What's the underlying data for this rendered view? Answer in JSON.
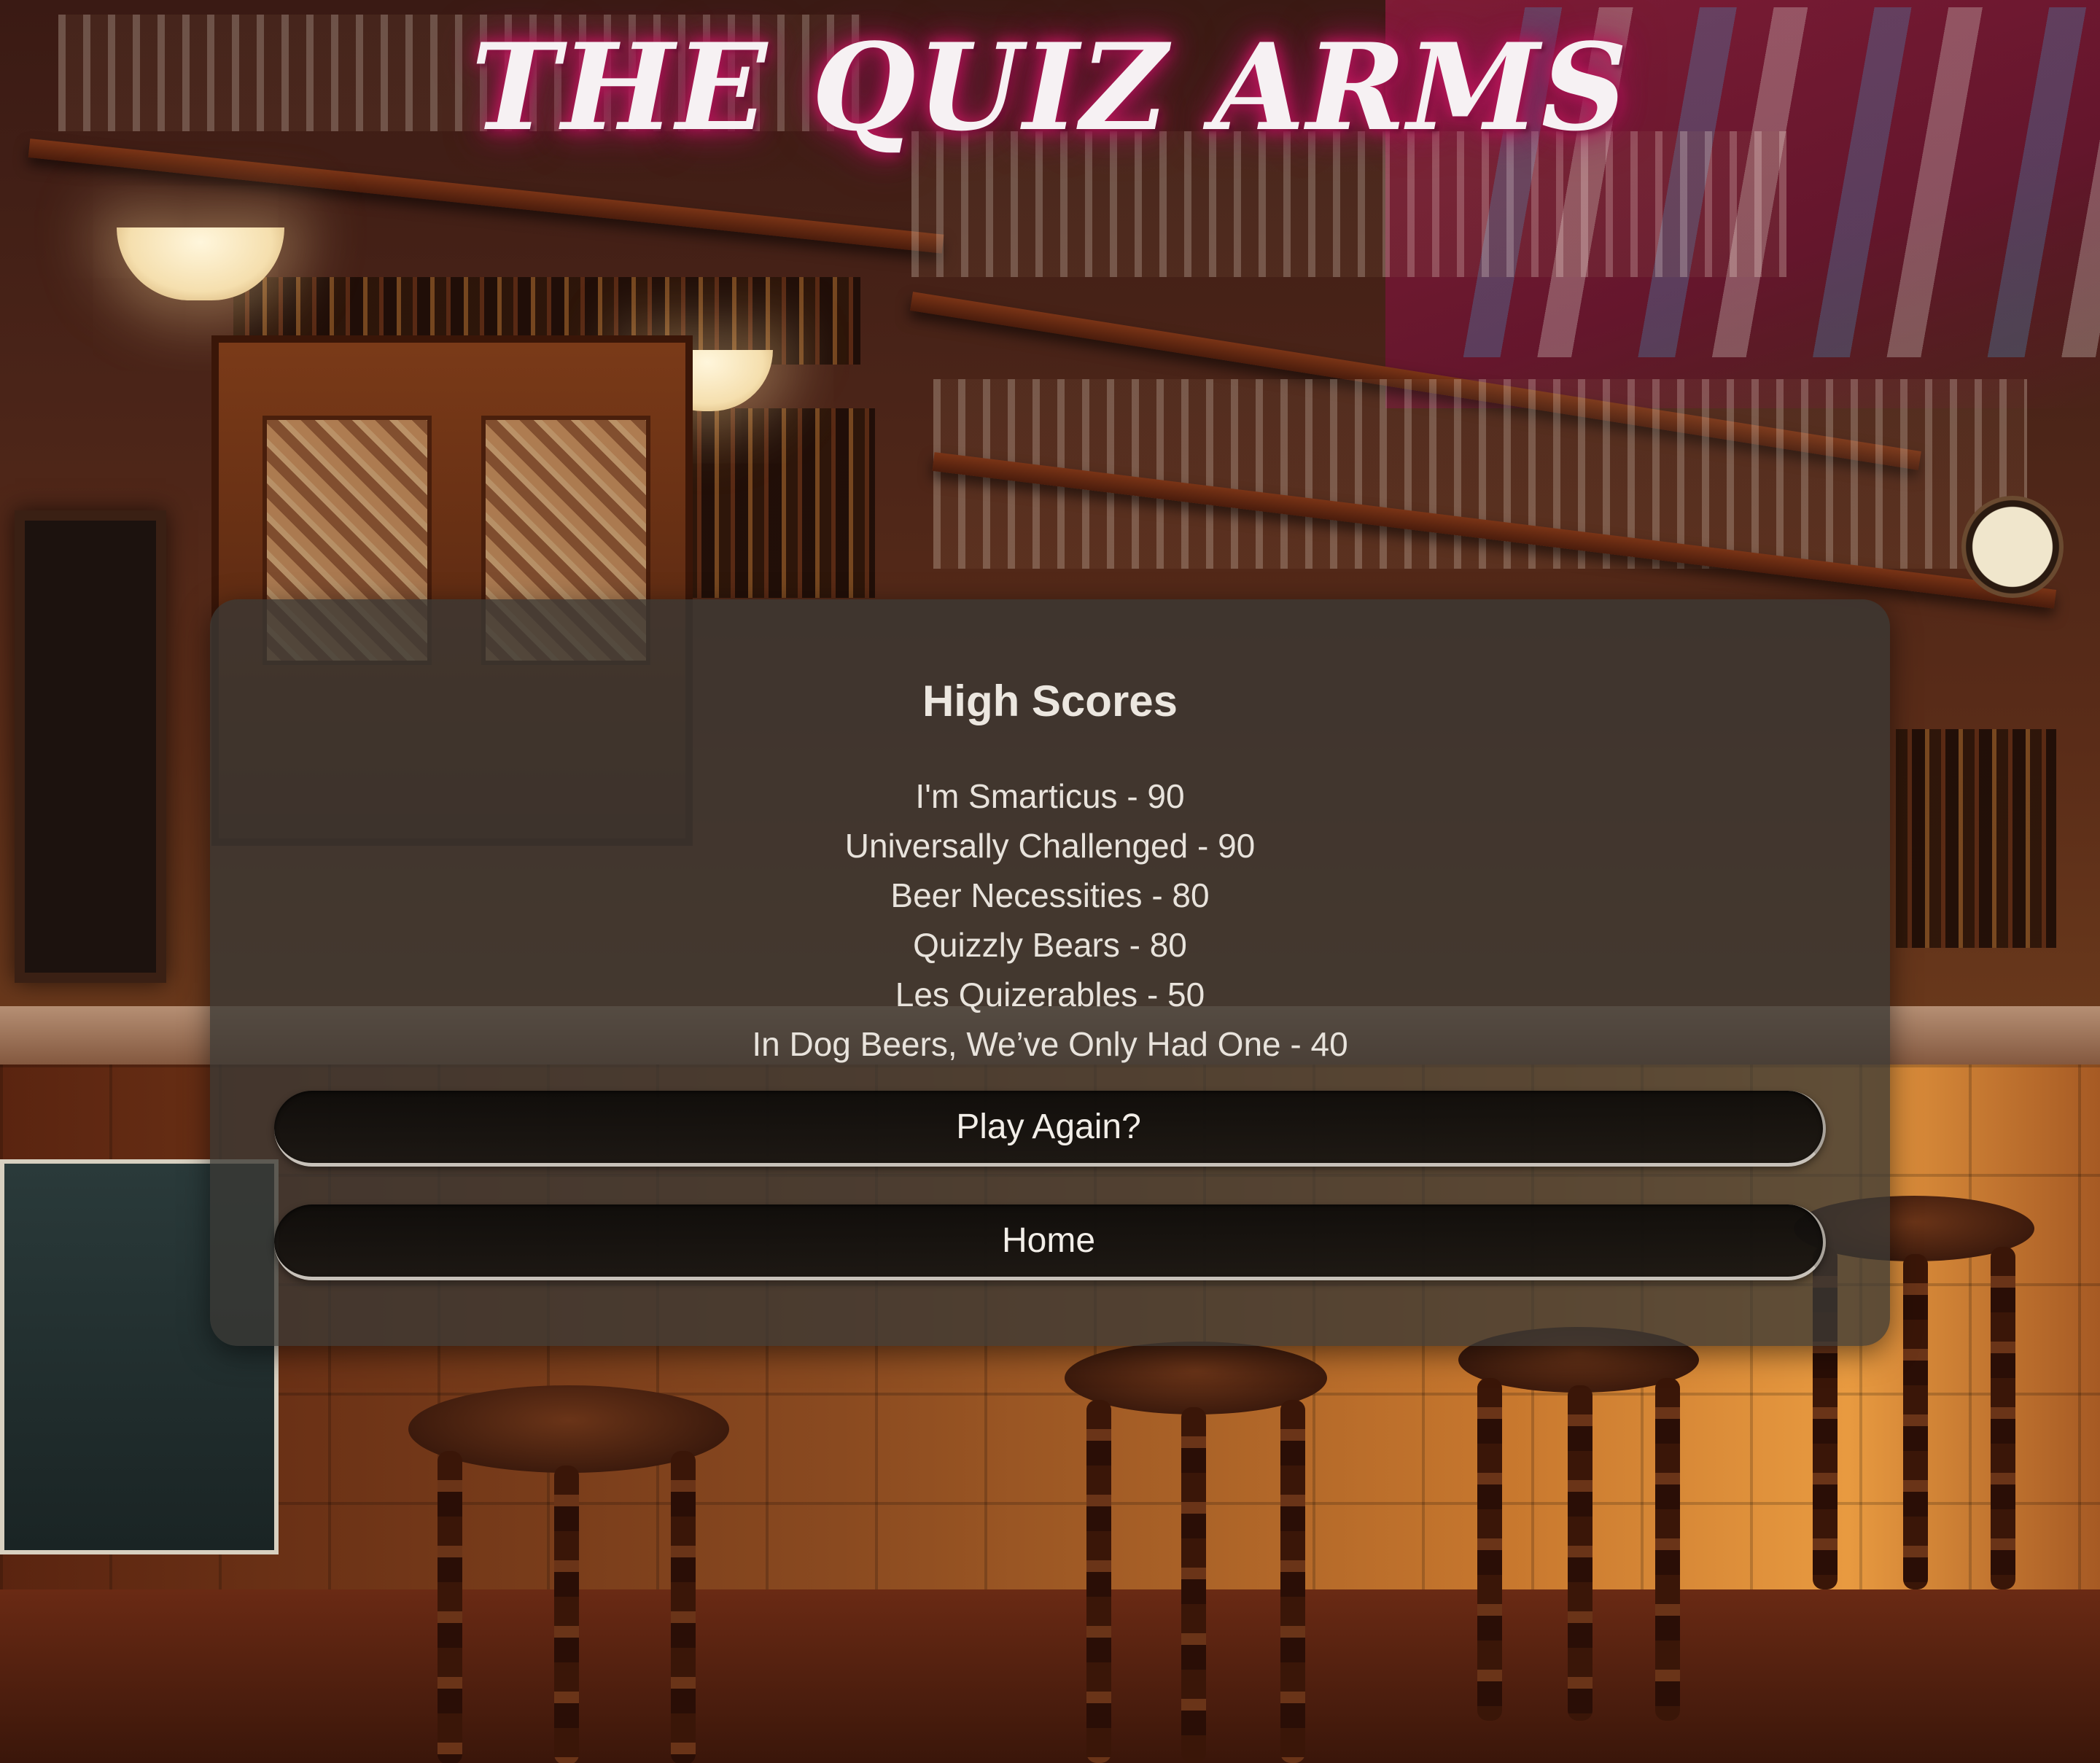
{
  "header": {
    "title": "THE QUIZ ARMS"
  },
  "high_scores": {
    "heading": "High Scores",
    "entries": [
      "I'm Smarticus - 90",
      "Universally Challenged - 90",
      "Beer Necessities - 80",
      "Quizzly Bears - 80",
      "Les Quizerables - 50",
      "In Dog Beers, We’ve Only Had One - 40"
    ]
  },
  "buttons": {
    "play_again": "Play Again?",
    "home": "Home"
  },
  "colors": {
    "title_text": "#f6f1f3",
    "title_glow": "#c2185b",
    "card_background": "#3a3834",
    "button_background": "#0c0a08",
    "text": "#e8e3dc"
  }
}
